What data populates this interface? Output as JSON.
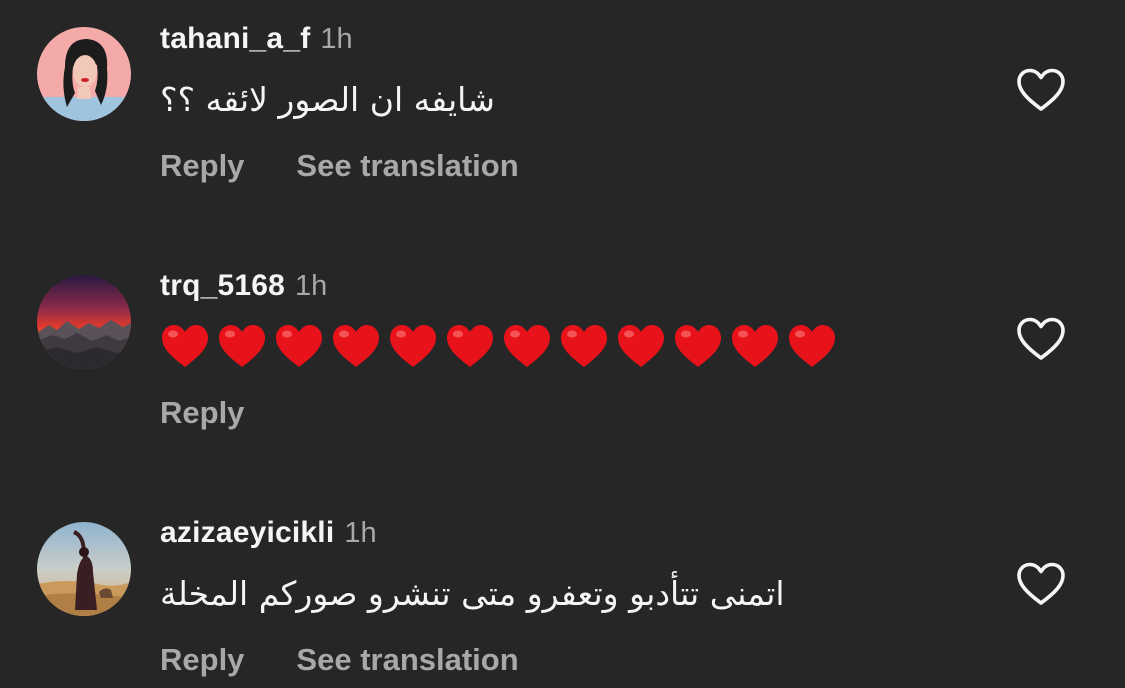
{
  "comments": [
    {
      "username": "tahani_a_f",
      "time": "1h",
      "text": "شايفه ان الصور لائقه ؟؟",
      "reply_label": "Reply",
      "translate_label": "See translation",
      "avatar": "illustrated-woman-avatar"
    },
    {
      "username": "trq_5168",
      "time": "1h",
      "emoji": "red-heart",
      "emoji_count": 12,
      "reply_label": "Reply",
      "avatar": "sunset-mountains-avatar"
    },
    {
      "username": "azizaeyicikli",
      "time": "1h",
      "text": "اتمنى تتأدبو وتعفرو متى تنشرو صوركم المخلة",
      "reply_label": "Reply",
      "translate_label": "See translation",
      "avatar": "person-desert-avatar"
    }
  ],
  "colors": {
    "background": "#262626",
    "primary_text": "#f5f5f5",
    "secondary_text": "#a8a8a8",
    "heart_red": "#e8121a"
  }
}
